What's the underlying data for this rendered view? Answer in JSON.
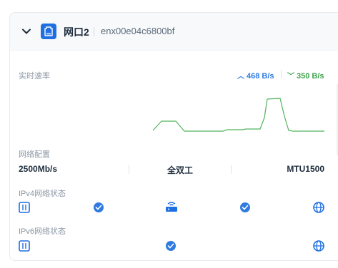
{
  "port": {
    "name": "网口2",
    "interface_id": "enx00e04c6800bf",
    "icons": {
      "collapse": "chevron-down-icon",
      "port": "ethernet-port-icon"
    }
  },
  "realtime": {
    "label": "实时速率",
    "upload": "468 B/s",
    "download": "350 B/s",
    "upload_color": "#2f7be0",
    "download_color": "#3fa34d"
  },
  "config": {
    "label": "网络配置",
    "speed": "2500Mb/s",
    "duplex": "全双工",
    "mtu": "MTU1500"
  },
  "ipv4": {
    "label": "IPv4网络状态",
    "nodes": [
      "port-icon",
      "check-icon",
      "router-icon",
      "check-icon",
      "globe-icon"
    ]
  },
  "ipv6": {
    "label": "IPv6网络状态",
    "nodes": [
      "port-icon",
      "check-icon",
      "globe-icon"
    ]
  },
  "accent": "#2f7be0"
}
